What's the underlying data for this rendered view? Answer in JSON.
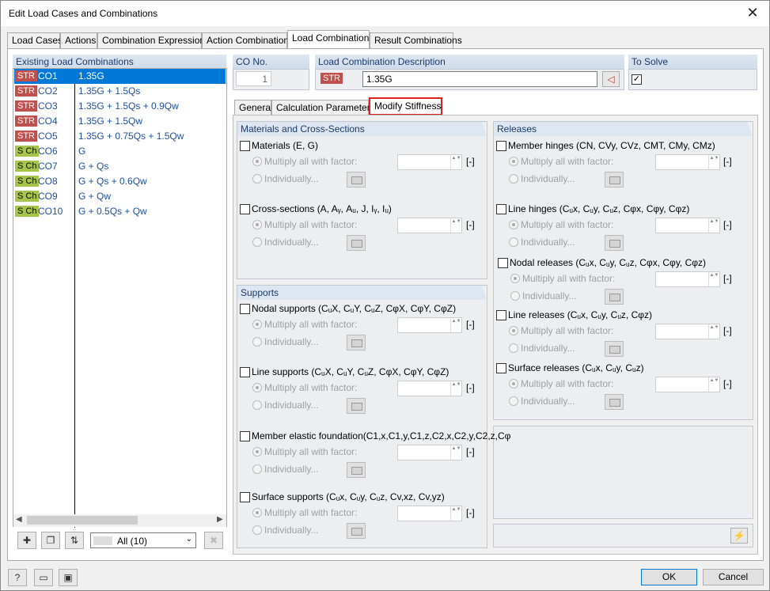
{
  "window": {
    "title": "Edit Load Cases and Combinations"
  },
  "tabs": [
    "Load Cases",
    "Actions",
    "Combination Expressions",
    "Action Combinations",
    "Load Combinations",
    "Result Combinations"
  ],
  "left_panel": {
    "title": "Existing Load Combinations",
    "items": [
      {
        "badge": "STR",
        "name": "CO1",
        "expression": "1.35G"
      },
      {
        "badge": "STR",
        "name": "CO2",
        "expression": "1.35G + 1.5Qs"
      },
      {
        "badge": "STR",
        "name": "CO3",
        "expression": "1.35G + 1.5Qs + 0.9Qw"
      },
      {
        "badge": "STR",
        "name": "CO4",
        "expression": "1.35G + 1.5Qw"
      },
      {
        "badge": "STR",
        "name": "CO5",
        "expression": "1.35G + 0.75Qs + 1.5Qw"
      },
      {
        "badge": "S Ch",
        "name": "CO6",
        "expression": "G"
      },
      {
        "badge": "S Ch",
        "name": "CO7",
        "expression": "G + Qs"
      },
      {
        "badge": "S Ch",
        "name": "CO8",
        "expression": "G + Qs + 0.6Qw"
      },
      {
        "badge": "S Ch",
        "name": "CO9",
        "expression": "G + Qw"
      },
      {
        "badge": "S Ch",
        "name": "CO10",
        "expression": "G + 0.5Qs + Qw"
      }
    ],
    "filter_value": "All (10)"
  },
  "co_no": {
    "label": "CO No.",
    "value": "1"
  },
  "description": {
    "label": "Load Combination Description",
    "badge": "STR",
    "value": "1.35G"
  },
  "to_solve": {
    "label": "To Solve"
  },
  "subtabs": [
    "General",
    "Calculation Parameters",
    "Modify Stiffness"
  ],
  "materials_group": {
    "title": "Materials and Cross-Sections",
    "items": [
      "Materials (E, G)",
      "Cross-sections (A, Aᵧ, Aᵤ, J, Iᵧ, Iᵤ)"
    ]
  },
  "supports_group": {
    "title": "Supports",
    "items": [
      "Nodal supports (CᵤX, CᵤY, CᵤZ, CφX, CφY, CφZ)",
      "Line supports (CᵤX, CᵤY, CᵤZ, CφX, CφY, CφZ)",
      "Member elastic foundation(C1,x,C1,y,C1,z,C2,x,C2,y,C2,z,Cφ",
      "Surface supports (Cᵤx, Cᵤy, Cᵤz, Cv,xz, Cv,yz)"
    ]
  },
  "releases_group": {
    "title": "Releases",
    "items": [
      "Member hinges (CN, CVy, CVz, CMT, CMy, CMz)",
      "Line hinges (Cᵤx, Cᵤy, Cᵤz, Cφx, Cφy, Cφz)",
      "Nodal releases (Cᵤx, Cᵤy, Cᵤz, Cφx, Cφy, Cφz)",
      "Line releases (Cᵤx, Cᵤy, Cᵤz, Cφz)",
      "Surface releases (Cᵤx, Cᵤy, Cᵤz)"
    ]
  },
  "option_labels": {
    "multiply": "Multiply all with factor:",
    "individually": "Individually...",
    "unit": "[-]"
  },
  "footer": {
    "ok": "OK",
    "cancel": "Cancel"
  }
}
